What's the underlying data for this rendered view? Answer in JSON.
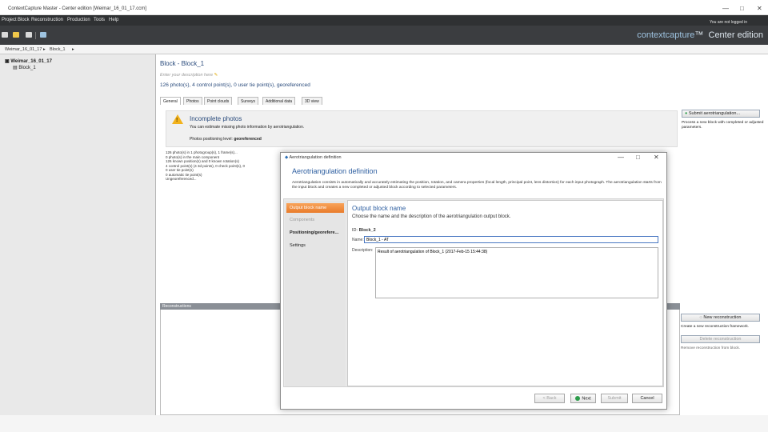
{
  "window": {
    "title": "ContextCapture Master - Center edition [Weimar_16_01_17.ccm]",
    "min_label": "—",
    "max_label": "□",
    "close_label": "✕"
  },
  "menu": [
    "Project",
    "Block",
    "Reconstruction",
    "Production",
    "Tools",
    "Help"
  ],
  "login_status": "You are not logged in",
  "brand": {
    "name": "contextcapture",
    "tm": "™",
    "edition": "Center edition"
  },
  "breadcrumb": [
    "Weimar_16_01_17",
    "Block_1"
  ],
  "project_tree": {
    "root": "Weimar_16_01_17",
    "child": "Block_1"
  },
  "block": {
    "title": "Block - Block_1",
    "description_placeholder": "Enter your description here",
    "stats": "126 photo(s), 4 control point(s), 0 user tie point(s), georeferenced",
    "tabs": [
      "General",
      "Photos",
      "Point clouds",
      "Surveys",
      "Additional data",
      "3D view"
    ]
  },
  "warning": {
    "title": "Incomplete photos",
    "text": "You can estimate missing photo information by aerotriangulation.",
    "level_label": "Photos positioning level:",
    "level_value": "georeferenced"
  },
  "summary_lines": [
    "126 photo(s) in 1 photogroup(s), 1 frame(s)...",
    "0 photo(s) in the main component",
    "126 known position(s) and 0 known rotation(s)",
    "4 control point(s) (4 3d points), 0 check point(s), 0",
    "0 user tie point(s)",
    "0 automatic tie point(s)",
    "Ungeoreferenced..."
  ],
  "aero_action": {
    "button": "Submit aerotriangulation...",
    "text": "Process a new block with completed or adjusted parameters."
  },
  "reconstructions": {
    "header": "Reconstructions",
    "new_button": "New reconstruction",
    "new_text": "Create a new reconstruction framework.",
    "delete_button": "Delete reconstruction",
    "delete_text": "Remove reconstruction from block."
  },
  "dialog": {
    "title": "Aerotriangulation definition",
    "heading": "Aerotriangulation definition",
    "description": "Aerotriangulation consists in automatically and accurately estimating the position, rotation, and camera properties (focal length, principal point, lens distortion) for each input photograph. The aerotriangulation starts from the input block and creates a new completed or adjusted block according to selected parameters.",
    "steps": [
      "Output block name",
      "Components",
      "Positioning/georefere...",
      "Settings"
    ],
    "content_title": "Output block name",
    "content_subtitle": "Choose the name and the description of the aerotriangulation output block.",
    "id_label": "ID:",
    "id_value": "Block_2",
    "name_label": "Name:",
    "name_value": "Block_1 - AT",
    "desc_label": "Description:",
    "desc_value": "Result of aerotriangulation of Block_1 (2017-Feb-15 15:44:38)",
    "buttons": {
      "back": "< Back",
      "next": "Next",
      "submit": "Submit",
      "cancel": "Cancel"
    }
  }
}
